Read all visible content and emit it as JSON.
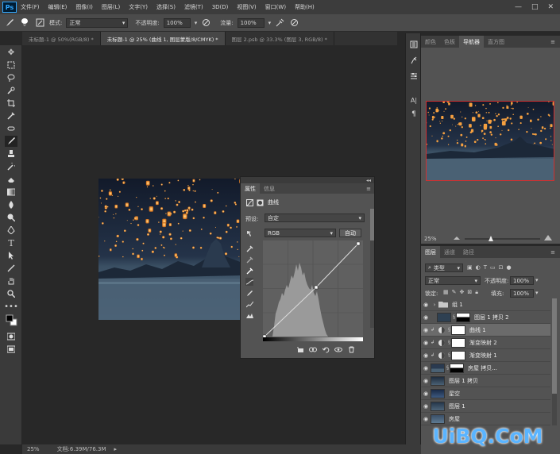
{
  "app": {
    "logo": "Ps"
  },
  "menu": [
    "文件(F)",
    "编辑(E)",
    "图像(I)",
    "图层(L)",
    "文字(Y)",
    "选择(S)",
    "滤镜(T)",
    "3D(D)",
    "视图(V)",
    "窗口(W)",
    "帮助(H)"
  ],
  "window_controls": {
    "minimize": "—",
    "maximize": "□",
    "close": "✕"
  },
  "options": {
    "brush_size": "0",
    "mode_label": "模式:",
    "mode_value": "正常",
    "opacity_label": "不透明度:",
    "opacity_value": "100%",
    "flow_label": "流量:",
    "flow_value": "100%"
  },
  "tabs": [
    {
      "label": "未标题-1 @ 50%(RGB/8) *",
      "active": false
    },
    {
      "label": "未标题-1 @ 25% (曲线 1, 图层蒙版/8/CMYK) *",
      "active": true
    },
    {
      "label": "图层 2.psb @ 33.3% (图层 3, RGB/8) *",
      "active": false
    }
  ],
  "status": {
    "zoom": "25%",
    "doc": "文档:6.39M/76.3M"
  },
  "properties": {
    "tab_active": "属性",
    "tab_other": "信息",
    "title": "曲线",
    "preset_label": "预设:",
    "preset_value": "自定",
    "channel_value": "RGB",
    "auto_button": "自动"
  },
  "navigator": {
    "tabs": [
      "颜色",
      "色板",
      "导航器",
      "直方图"
    ],
    "active_tab": "导航器",
    "zoom": "25%"
  },
  "layers_panel": {
    "tabs": [
      "图层",
      "通道",
      "路径"
    ],
    "filter_value": "类型",
    "blend_value": "正常",
    "opacity_label": "不透明度:",
    "opacity_value": "100%",
    "lock_label": "锁定:",
    "fill_label": "填充:",
    "fill_value": "100%",
    "layers": [
      {
        "name": "组 1",
        "kind": "group",
        "selected": false
      },
      {
        "name": "图层 1 拷贝 2",
        "kind": "image-mask",
        "selected": false
      },
      {
        "name": "曲线 1",
        "kind": "adjust",
        "selected": true
      },
      {
        "name": "渐变映射 2",
        "kind": "adjust",
        "selected": false
      },
      {
        "name": "渐变映射 1",
        "kind": "adjust",
        "selected": false
      },
      {
        "name": "房屋 拷贝...",
        "kind": "image-mask",
        "selected": false
      },
      {
        "name": "图层 1 拷贝",
        "kind": "image",
        "selected": false
      },
      {
        "name": "星空",
        "kind": "image",
        "selected": false
      },
      {
        "name": "图层 1",
        "kind": "image",
        "selected": false
      },
      {
        "name": "房屋",
        "kind": "image",
        "selected": false
      }
    ]
  },
  "watermark": "UiBQ.CoM",
  "colors": {
    "accent": "#31a8ff",
    "panel": "#535353",
    "lantern": "#f5a040",
    "night_sky": "#1a2234",
    "water": "#4d6478"
  }
}
